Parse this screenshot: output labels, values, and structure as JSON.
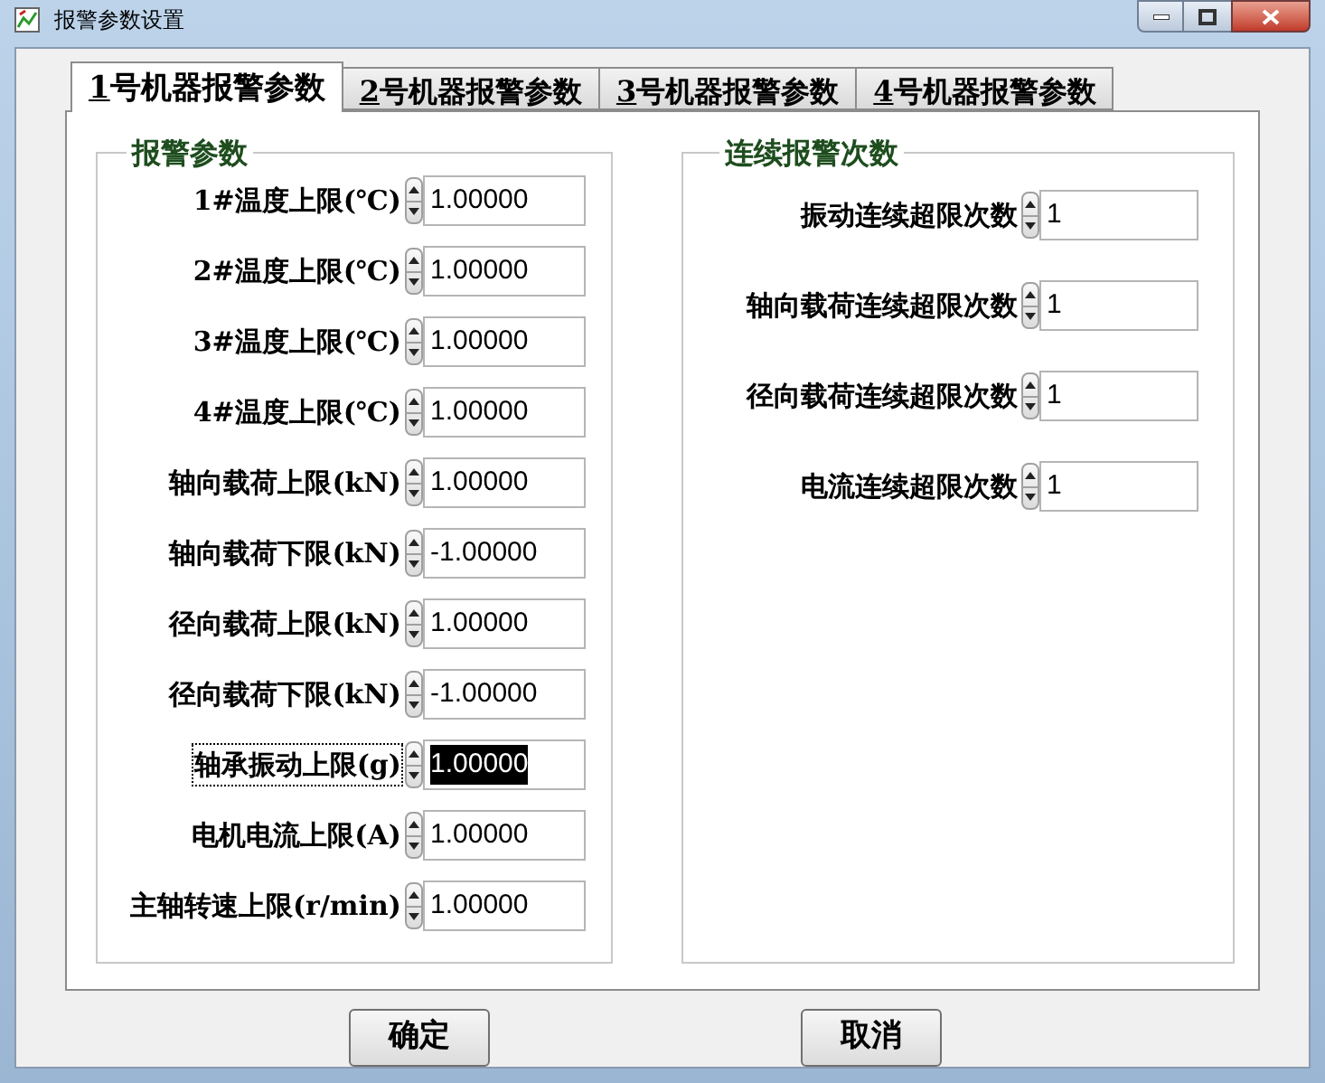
{
  "window": {
    "title": "报警参数设置"
  },
  "tabs": [
    {
      "label": "1号机器报警参数",
      "selected": true
    },
    {
      "label": "2号机器报警参数",
      "selected": false
    },
    {
      "label": "3号机器报警参数",
      "selected": false
    },
    {
      "label": "4号机器报警参数",
      "selected": false
    }
  ],
  "alarm_params": {
    "title": "报警参数",
    "fields": [
      {
        "label": "1#温度上限(℃)",
        "value": "1.00000",
        "focused": false
      },
      {
        "label": "2#温度上限(℃)",
        "value": "1.00000",
        "focused": false
      },
      {
        "label": "3#温度上限(℃)",
        "value": "1.00000",
        "focused": false
      },
      {
        "label": "4#温度上限(℃)",
        "value": "1.00000",
        "focused": false
      },
      {
        "label": "轴向载荷上限(kN)",
        "value": "1.00000",
        "focused": false
      },
      {
        "label": "轴向载荷下限(kN)",
        "value": "-1.00000",
        "focused": false
      },
      {
        "label": "径向载荷上限(kN)",
        "value": "1.00000",
        "focused": false
      },
      {
        "label": "径向载荷下限(kN)",
        "value": "-1.00000",
        "focused": false
      },
      {
        "label": "轴承振动上限(g)",
        "value": "1.00000",
        "focused": true
      },
      {
        "label": "电机电流上限(A)",
        "value": "1.00000",
        "focused": false
      },
      {
        "label": "主轴转速上限(r/min)",
        "value": "1.00000",
        "focused": false
      }
    ]
  },
  "consecutive_alarms": {
    "title": "连续报警次数",
    "fields": [
      {
        "label": "振动连续超限次数",
        "value": "1"
      },
      {
        "label": "轴向载荷连续超限次数",
        "value": "1"
      },
      {
        "label": "径向载荷连续超限次数",
        "value": "1"
      },
      {
        "label": "电流连续超限次数",
        "value": "1"
      }
    ]
  },
  "buttons": [
    "确定",
    "取消"
  ]
}
